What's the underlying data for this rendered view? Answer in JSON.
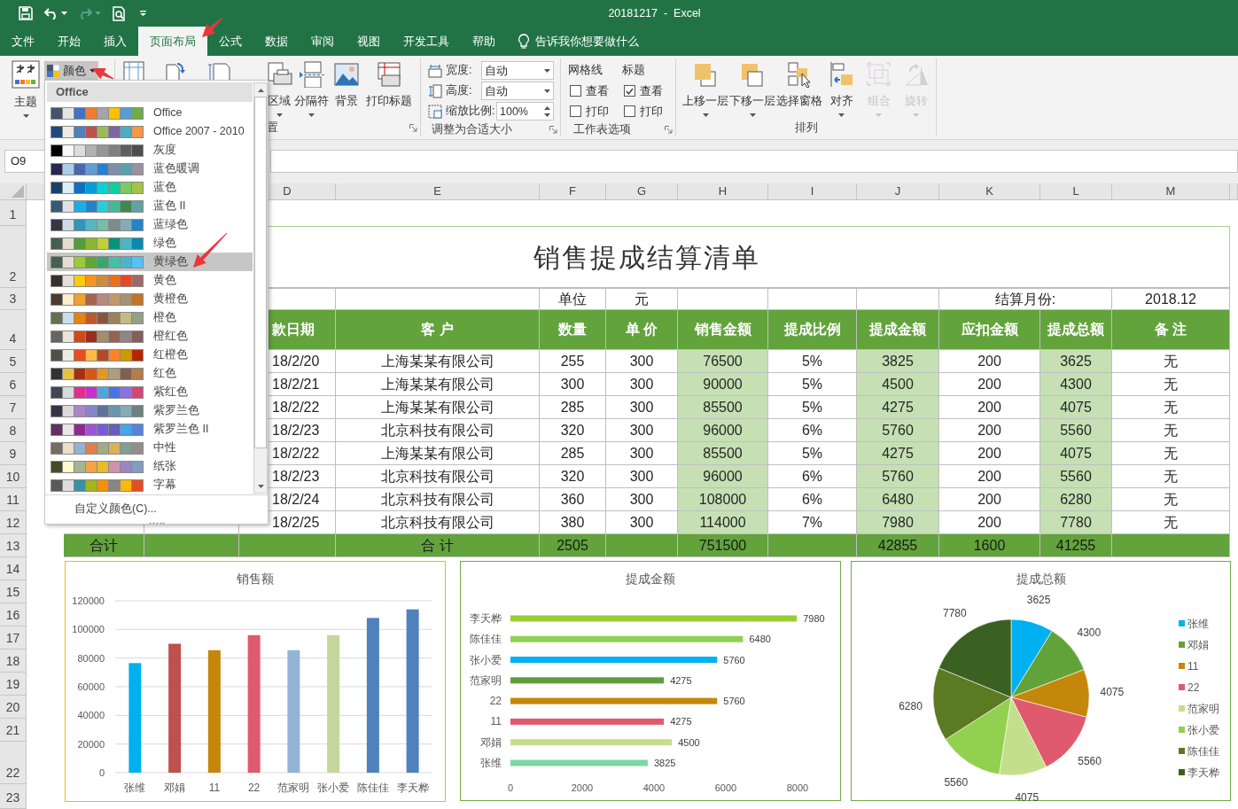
{
  "title_bar": {
    "title": "20181217  -  Excel"
  },
  "tabs": [
    {
      "label": "文件",
      "selected": false
    },
    {
      "label": "开始",
      "selected": false
    },
    {
      "label": "插入",
      "selected": false
    },
    {
      "label": "页面布局",
      "selected": true
    },
    {
      "label": "公式",
      "selected": false
    },
    {
      "label": "数据",
      "selected": false
    },
    {
      "label": "审阅",
      "selected": false
    },
    {
      "label": "视图",
      "selected": false
    },
    {
      "label": "开发工具",
      "selected": false
    },
    {
      "label": "帮助",
      "selected": false
    }
  ],
  "tell_me": {
    "placeholder": "告诉我你想要做什么"
  },
  "ribbon": {
    "theme_group": {
      "themes_button": "主题",
      "colors_button": "颜色"
    },
    "page_setup_group": {
      "buttons": [
        {
          "kind": "print_area",
          "label": "区域"
        },
        {
          "kind": "breaks",
          "label": "分隔符"
        },
        {
          "kind": "background",
          "label": "背景"
        },
        {
          "kind": "print_titles",
          "label": "打印标题"
        }
      ],
      "label": "置"
    },
    "fit_group": {
      "width_label": "宽度:",
      "width_value": "自动",
      "height_label": "高度:",
      "height_value": "自动",
      "scale_label": "缩放比例:",
      "scale_value": "100%",
      "label": "调整为合适大小"
    },
    "sheet_options_group": {
      "columns": [
        {
          "header": "网格线",
          "options": [
            {
              "label": "查看",
              "checked": false
            },
            {
              "label": "打印",
              "checked": false
            }
          ]
        },
        {
          "header": "标题",
          "options": [
            {
              "label": "查看",
              "checked": true
            },
            {
              "label": "打印",
              "checked": false
            }
          ]
        }
      ],
      "label": "工作表选项"
    },
    "arrange_group": {
      "buttons": [
        {
          "kind": "bring_forward",
          "label": "上移一层",
          "disabled": false
        },
        {
          "kind": "send_backward",
          "label": "下移一层",
          "disabled": false
        },
        {
          "kind": "selection_pane",
          "label": "选择窗格",
          "disabled": false
        },
        {
          "kind": "align",
          "label": "对齐",
          "disabled": false
        },
        {
          "kind": "group",
          "label": "组合",
          "disabled": true
        },
        {
          "kind": "rotate",
          "label": "旋转",
          "disabled": true
        }
      ],
      "label": "排列"
    }
  },
  "formula_bar": {
    "name_box": "O9"
  },
  "colors_menu": {
    "header": "Office",
    "footer": "自定义颜色(C)...",
    "items": [
      {
        "label": "Office",
        "selected": false,
        "swatches": [
          {
            "color": "#44546a"
          },
          {
            "color": "#e7e6e6"
          },
          {
            "color": "#4472c4"
          },
          {
            "color": "#ed7d31"
          },
          {
            "color": "#a5a5a5"
          },
          {
            "color": "#ffc000"
          },
          {
            "color": "#5b9bd5"
          },
          {
            "color": "#70ad47"
          }
        ]
      },
      {
        "label": "Office 2007 - 2010",
        "selected": false,
        "swatches": [
          {
            "color": "#1f497d"
          },
          {
            "color": "#eeece1"
          },
          {
            "color": "#4f81bd"
          },
          {
            "color": "#c0504d"
          },
          {
            "color": "#9bbb59"
          },
          {
            "color": "#8064a2"
          },
          {
            "color": "#4bacc6"
          },
          {
            "color": "#f79646"
          }
        ]
      },
      {
        "label": "灰度",
        "selected": false,
        "swatches": [
          {
            "color": "#000000"
          },
          {
            "color": "#f8f8f8"
          },
          {
            "color": "#dddddd"
          },
          {
            "color": "#b2b2b2"
          },
          {
            "color": "#969696"
          },
          {
            "color": "#808080"
          },
          {
            "color": "#5f5f5f"
          },
          {
            "color": "#4d4d4d"
          }
        ]
      },
      {
        "label": "蓝色暖调",
        "selected": false,
        "swatches": [
          {
            "color": "#242852"
          },
          {
            "color": "#acccea"
          },
          {
            "color": "#4a66ac"
          },
          {
            "color": "#629dd1"
          },
          {
            "color": "#297fd5"
          },
          {
            "color": "#7f8fa9"
          },
          {
            "color": "#5aa2ae"
          },
          {
            "color": "#9d90a0"
          }
        ]
      },
      {
        "label": "蓝色",
        "selected": false,
        "swatches": [
          {
            "color": "#17406d"
          },
          {
            "color": "#dbeff9"
          },
          {
            "color": "#0f6fc6"
          },
          {
            "color": "#009dd9"
          },
          {
            "color": "#0bd0d9"
          },
          {
            "color": "#10cf9b"
          },
          {
            "color": "#7cca62"
          },
          {
            "color": "#a5c249"
          }
        ]
      },
      {
        "label": "蓝色 II",
        "selected": false,
        "swatches": [
          {
            "color": "#335b74"
          },
          {
            "color": "#dfe3e5"
          },
          {
            "color": "#1cade4"
          },
          {
            "color": "#2683c6"
          },
          {
            "color": "#27ced7"
          },
          {
            "color": "#42ba97"
          },
          {
            "color": "#3e8853"
          },
          {
            "color": "#62a39f"
          }
        ]
      },
      {
        "label": "蓝绿色",
        "selected": false,
        "swatches": [
          {
            "color": "#373545"
          },
          {
            "color": "#cedbe6"
          },
          {
            "color": "#3494ba"
          },
          {
            "color": "#58b6c0"
          },
          {
            "color": "#75bda7"
          },
          {
            "color": "#7a8c8e"
          },
          {
            "color": "#84acb6"
          },
          {
            "color": "#2683c6"
          }
        ]
      },
      {
        "label": "绿色",
        "selected": false,
        "swatches": [
          {
            "color": "#455f51"
          },
          {
            "color": "#e3ded1"
          },
          {
            "color": "#549e39"
          },
          {
            "color": "#8ab833"
          },
          {
            "color": "#c0cf3a"
          },
          {
            "color": "#029676"
          },
          {
            "color": "#4ab5c4"
          },
          {
            "color": "#0989b1"
          }
        ]
      },
      {
        "label": "黄绿色",
        "selected": true,
        "swatches": [
          {
            "color": "#455f51"
          },
          {
            "color": "#e3ded1"
          },
          {
            "color": "#99cb38"
          },
          {
            "color": "#63a537"
          },
          {
            "color": "#37a76f"
          },
          {
            "color": "#44c1a3"
          },
          {
            "color": "#4eb3cf"
          },
          {
            "color": "#51c3f9"
          }
        ]
      },
      {
        "label": "黄色",
        "selected": false,
        "swatches": [
          {
            "color": "#39302a"
          },
          {
            "color": "#e5dedb"
          },
          {
            "color": "#ffca08"
          },
          {
            "color": "#f8931d"
          },
          {
            "color": "#ce8d3e"
          },
          {
            "color": "#ec7016"
          },
          {
            "color": "#e64823"
          },
          {
            "color": "#9c6a6a"
          }
        ]
      },
      {
        "label": "黄橙色",
        "selected": false,
        "swatches": [
          {
            "color": "#4e3b30"
          },
          {
            "color": "#fbeec9"
          },
          {
            "color": "#f0a22e"
          },
          {
            "color": "#a5644e"
          },
          {
            "color": "#b58b80"
          },
          {
            "color": "#c3986d"
          },
          {
            "color": "#a19574"
          },
          {
            "color": "#c17529"
          }
        ]
      },
      {
        "label": "橙色",
        "selected": false,
        "swatches": [
          {
            "color": "#637052"
          },
          {
            "color": "#ccddea"
          },
          {
            "color": "#e48312"
          },
          {
            "color": "#bd582c"
          },
          {
            "color": "#865640"
          },
          {
            "color": "#9b8357"
          },
          {
            "color": "#c2bc80"
          },
          {
            "color": "#94a088"
          }
        ]
      },
      {
        "label": "橙红色",
        "selected": false,
        "swatches": [
          {
            "color": "#696464"
          },
          {
            "color": "#e9e5dc"
          },
          {
            "color": "#d34817"
          },
          {
            "color": "#9b2d1f"
          },
          {
            "color": "#a28e6a"
          },
          {
            "color": "#956251"
          },
          {
            "color": "#918485"
          },
          {
            "color": "#855d5d"
          }
        ]
      },
      {
        "label": "红橙色",
        "selected": false,
        "swatches": [
          {
            "color": "#505046"
          },
          {
            "color": "#eeece1"
          },
          {
            "color": "#e84c22"
          },
          {
            "color": "#ffbd47"
          },
          {
            "color": "#b64926"
          },
          {
            "color": "#ff8427"
          },
          {
            "color": "#cc9900"
          },
          {
            "color": "#b22600"
          }
        ]
      },
      {
        "label": "红色",
        "selected": false,
        "swatches": [
          {
            "color": "#323232"
          },
          {
            "color": "#e5c243"
          },
          {
            "color": "#a5300f"
          },
          {
            "color": "#d55816"
          },
          {
            "color": "#e19825"
          },
          {
            "color": "#b19c7d"
          },
          {
            "color": "#7f5f52"
          },
          {
            "color": "#b27d49"
          }
        ]
      },
      {
        "label": "紫红色",
        "selected": false,
        "swatches": [
          {
            "color": "#454551"
          },
          {
            "color": "#d8d9dc"
          },
          {
            "color": "#e32d91"
          },
          {
            "color": "#c830cc"
          },
          {
            "color": "#4ea6dc"
          },
          {
            "color": "#4775e7"
          },
          {
            "color": "#8971e1"
          },
          {
            "color": "#d54773"
          }
        ]
      },
      {
        "label": "紫罗兰色",
        "selected": false,
        "swatches": [
          {
            "color": "#373545"
          },
          {
            "color": "#dcd8dc"
          },
          {
            "color": "#ad84c6"
          },
          {
            "color": "#8784c7"
          },
          {
            "color": "#5d739a"
          },
          {
            "color": "#6997af"
          },
          {
            "color": "#84acb6"
          },
          {
            "color": "#6f8183"
          }
        ]
      },
      {
        "label": "紫罗兰色 II",
        "selected": false,
        "swatches": [
          {
            "color": "#632e62"
          },
          {
            "color": "#eae5eb"
          },
          {
            "color": "#92278f"
          },
          {
            "color": "#9b57d3"
          },
          {
            "color": "#755dd9"
          },
          {
            "color": "#665eb8"
          },
          {
            "color": "#45a5ed"
          },
          {
            "color": "#5982db"
          }
        ]
      },
      {
        "label": "中性",
        "selected": false,
        "swatches": [
          {
            "color": "#776c61"
          },
          {
            "color": "#eddec6"
          },
          {
            "color": "#93b2d4"
          },
          {
            "color": "#df8149"
          },
          {
            "color": "#a2ab83"
          },
          {
            "color": "#dbb154"
          },
          {
            "color": "#7ea197"
          },
          {
            "color": "#968d8c"
          }
        ]
      },
      {
        "label": "纸张",
        "selected": false,
        "swatches": [
          {
            "color": "#444d26"
          },
          {
            "color": "#fefac9"
          },
          {
            "color": "#a5b592"
          },
          {
            "color": "#f3a447"
          },
          {
            "color": "#e7bc29"
          },
          {
            "color": "#d092a7"
          },
          {
            "color": "#9c85c0"
          },
          {
            "color": "#809ec2"
          }
        ]
      },
      {
        "label": "字幕",
        "selected": false,
        "swatches": [
          {
            "color": "#595959"
          },
          {
            "color": "#dddddd"
          },
          {
            "color": "#3891a7"
          },
          {
            "color": "#a5b31c"
          },
          {
            "color": "#f39200"
          },
          {
            "color": "#868686"
          },
          {
            "color": "#feb80a"
          },
          {
            "color": "#e34d24"
          }
        ]
      }
    ]
  },
  "sheet": {
    "column_headers": [
      "D",
      "E",
      "F",
      "G",
      "H",
      "I",
      "J",
      "K",
      "L",
      "M"
    ],
    "row_headers": [
      "1",
      "2",
      "3",
      "4",
      "5",
      "6",
      "7",
      "8",
      "9",
      "10",
      "11",
      "12",
      "13",
      "14",
      "15",
      "16",
      "17",
      "18",
      "19",
      "20",
      "21",
      "22",
      "23"
    ],
    "title": "销售提成结算清单",
    "unit_row": {
      "F": "单位",
      "G": "元",
      "K": "结算月份:",
      "M": "2018.12"
    },
    "header_row": {
      "D": "款日期",
      "E": "客 户",
      "F": "数量",
      "G": "单 价",
      "H": "销售金额",
      "I": "提成比例",
      "J": "提成金额",
      "K": "应扣金额",
      "L": "提成总额",
      "M": "备 注"
    },
    "data_rows": [
      {
        "D": "18/2/20",
        "E": "上海某某有限公司",
        "F": "255",
        "G": "300",
        "H": "76500",
        "I": "5%",
        "J": "3825",
        "K": "200",
        "L": "3625",
        "M": "无"
      },
      {
        "D": "18/2/21",
        "E": "上海某某有限公司",
        "F": "300",
        "G": "300",
        "H": "90000",
        "I": "5%",
        "J": "4500",
        "K": "200",
        "L": "4300",
        "M": "无"
      },
      {
        "D": "18/2/22",
        "E": "上海某某有限公司",
        "F": "285",
        "G": "300",
        "H": "85500",
        "I": "5%",
        "J": "4275",
        "K": "200",
        "L": "4075",
        "M": "无"
      },
      {
        "D": "18/2/23",
        "E": "北京科技有限公司",
        "F": "320",
        "G": "300",
        "H": "96000",
        "I": "6%",
        "J": "5760",
        "K": "200",
        "L": "5560",
        "M": "无"
      },
      {
        "D": "18/2/22",
        "E": "上海某某有限公司",
        "F": "285",
        "G": "300",
        "H": "85500",
        "I": "5%",
        "J": "4275",
        "K": "200",
        "L": "4075",
        "M": "无"
      },
      {
        "D": "18/2/23",
        "E": "北京科技有限公司",
        "F": "320",
        "G": "300",
        "H": "96000",
        "I": "6%",
        "J": "5760",
        "K": "200",
        "L": "5560",
        "M": "无"
      },
      {
        "D": "18/2/24",
        "E": "北京科技有限公司",
        "F": "360",
        "G": "300",
        "H": "108000",
        "I": "6%",
        "J": "6480",
        "K": "200",
        "L": "6280",
        "M": "无"
      },
      {
        "D": "18/2/25",
        "E": "北京科技有限公司",
        "F": "380",
        "G": "300",
        "H": "114000",
        "I": "7%",
        "J": "7980",
        "K": "200",
        "L": "7780",
        "M": "无"
      }
    ],
    "total_row": {
      "B": "合计",
      "E": "合 计",
      "F": "2505",
      "H": "751500",
      "J": "42855",
      "K": "1600",
      "L": "41255"
    }
  },
  "charts": [
    {
      "chart_data": {
        "type": "bar",
        "title": "销售额",
        "grid": true,
        "categories": [
          "张维",
          "邓娟",
          "11",
          "22",
          "范家明",
          "张小爱",
          "陈佳佳",
          "李天桦"
        ],
        "ylim": [
          0,
          120000
        ],
        "yticks": [
          0,
          20000,
          40000,
          60000,
          80000,
          100000,
          120000
        ],
        "series": [
          {
            "colors": [
              "#00b0f0",
              "#c0504d",
              "#c5870a",
              "#e05a6e",
              "#95b3d7",
              "#c4d79b",
              "#4f81bd",
              "#4f81bd"
            ],
            "values": [
              76500,
              90000,
              85500,
              96000,
              85500,
              96000,
              108000,
              114000
            ]
          }
        ]
      }
    },
    {
      "chart_data": {
        "type": "bar",
        "orientation": "horizontal",
        "title": "提成金额",
        "categories": [
          "李天桦",
          "陈佳佳",
          "张小爱",
          "范家明",
          "22",
          "11",
          "邓娟",
          "张维"
        ],
        "xlim": [
          0,
          8000
        ],
        "xticks": [
          0,
          2000,
          4000,
          6000,
          8000
        ],
        "value_labels": [
          "7980",
          "6480",
          "5760",
          "4275",
          "5760",
          "4275",
          "4500",
          "3825"
        ],
        "series": [
          {
            "colors": [
              "#9acd32",
              "#92d050",
              "#00b0f0",
              "#5e9e3a",
              "#c5870a",
              "#e05a6e",
              "#c4df8b",
              "#7dd6a6"
            ],
            "values": [
              7980,
              6480,
              5760,
              4275,
              5760,
              4275,
              4500,
              3825
            ]
          }
        ]
      }
    },
    {
      "chart_data": {
        "type": "pie",
        "title": "提成总额",
        "legend": true,
        "categories": [
          "张维",
          "邓娟",
          "11",
          "22",
          "范家明",
          "张小爱",
          "陈佳佳",
          "李天桦"
        ],
        "value_labels": [
          "3625",
          "4300",
          "4075",
          "5560",
          "4075",
          "5560",
          "6280",
          "7780"
        ],
        "series": [
          {
            "colors": [
              "#00b0f0",
              "#62a339",
              "#c5870a",
              "#e05a6e",
              "#c4df8b",
              "#92d050",
              "#5b7a22",
              "#3a6121"
            ],
            "values": [
              8.79,
              10.42,
              9.88,
              13.48,
              9.88,
              13.48,
              15.22,
              18.85
            ]
          }
        ]
      }
    }
  ]
}
